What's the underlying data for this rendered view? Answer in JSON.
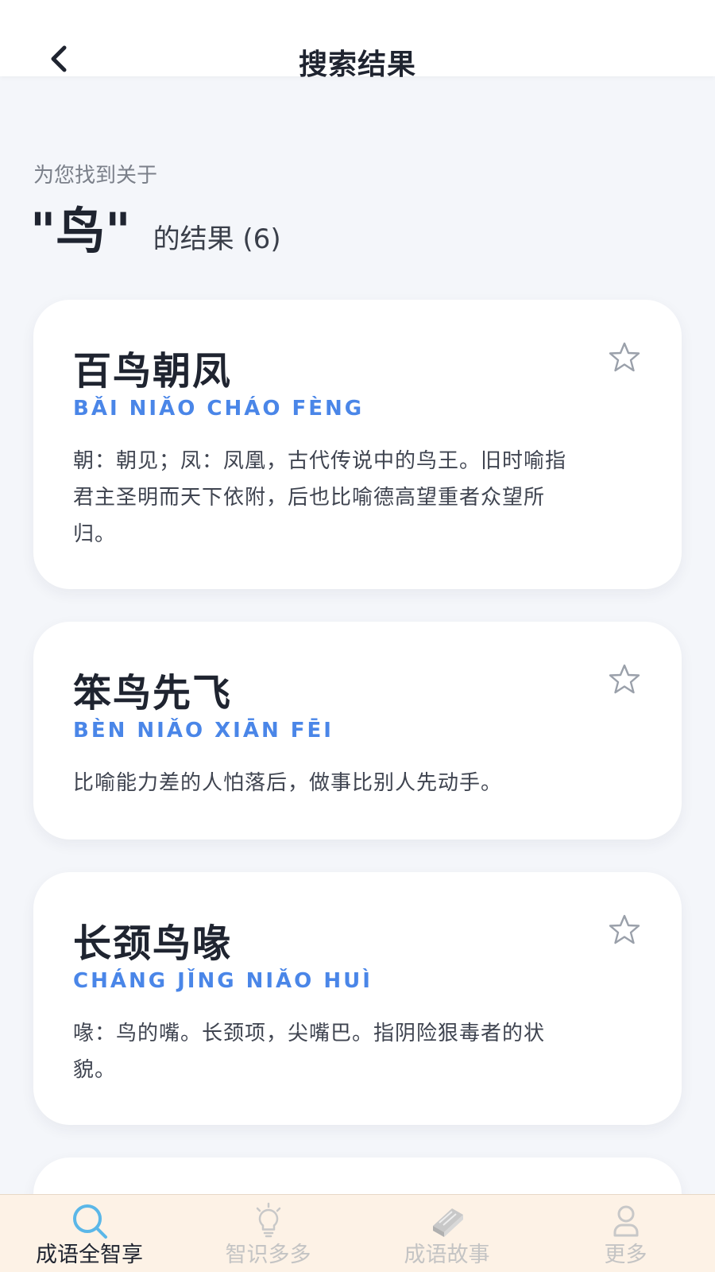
{
  "header": {
    "title": "搜索结果"
  },
  "summary": {
    "pre_text": "为您找到关于",
    "keyword": "\"鸟\"",
    "suffix": "的结果 (6)"
  },
  "results": [
    {
      "title": "百鸟朝凤",
      "pinyin": "BǍI NIǍO CHÁO FÈNG",
      "desc": "朝：朝见；凤：凤凰，古代传说中的鸟王。旧时喻指君主圣明而天下依附，后也比喻德高望重者众望所归。"
    },
    {
      "title": "笨鸟先飞",
      "pinyin": "BÈN NIǍO XIĀN FĒI",
      "desc": "比喻能力差的人怕落后，做事比别人先动手。"
    },
    {
      "title": "长颈鸟喙",
      "pinyin": "CHÁNG JǏNG NIǍO HUÌ",
      "desc": "喙：鸟的嘴。长颈项，尖嘴巴。指阴险狠毒者的状貌。"
    }
  ],
  "tabs": [
    {
      "label": "成语全智享",
      "icon": "search-icon",
      "active": true
    },
    {
      "label": "智识多多",
      "icon": "lightbulb-icon",
      "active": false
    },
    {
      "label": "成语故事",
      "icon": "book-icon",
      "active": false
    },
    {
      "label": "更多",
      "icon": "user-icon",
      "active": false
    }
  ],
  "colors": {
    "accent": "#4a86e8",
    "active_tab_icon": "#5bb7e8",
    "tab_bar_bg": "#fdf2e6",
    "page_bg": "#f4f6fa"
  }
}
